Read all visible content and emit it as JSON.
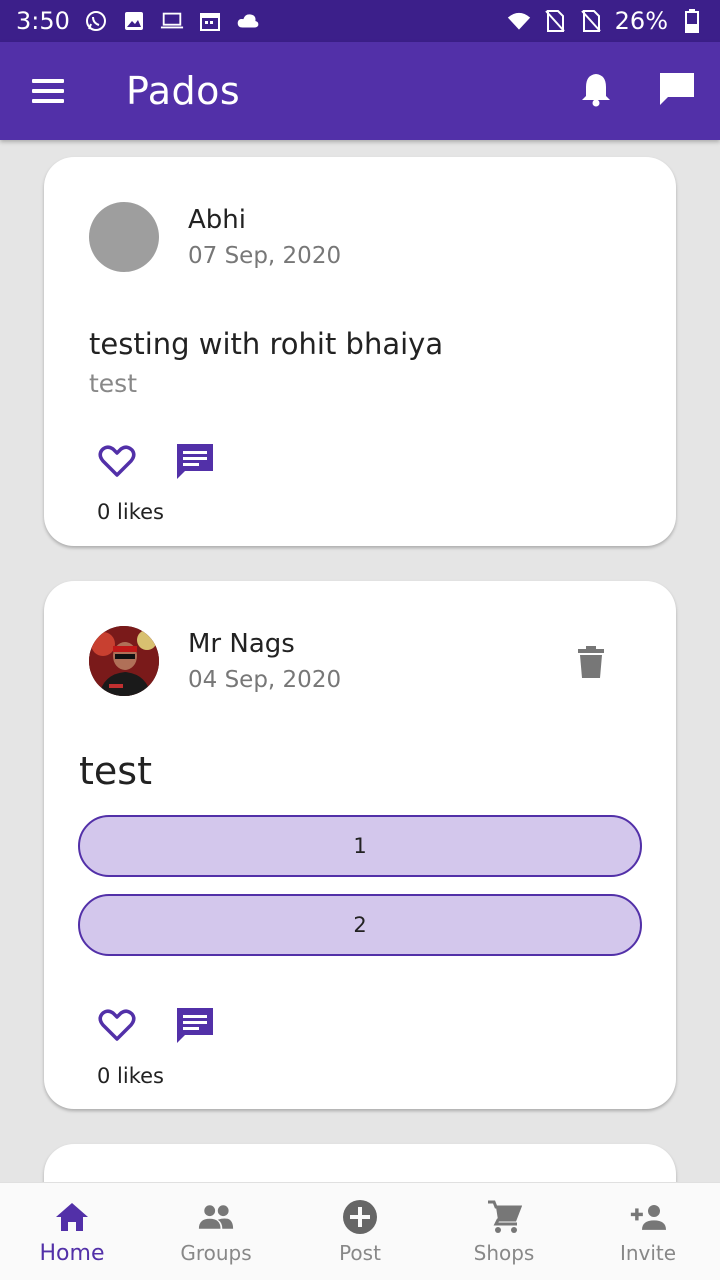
{
  "status_bar": {
    "time": "3:50",
    "battery": "26%"
  },
  "app_bar": {
    "title": "Pados"
  },
  "posts": [
    {
      "author": "Abhi",
      "date": "07 Sep, 2020",
      "title": "testing with rohit bhaiya",
      "body": "test",
      "likes": "0 likes"
    },
    {
      "author": "Mr Nags",
      "date": "04 Sep, 2020",
      "title": "test",
      "options": [
        "1",
        "2"
      ],
      "likes": "0 likes"
    }
  ],
  "bottom_nav": [
    {
      "label": "Home",
      "icon": "home-icon",
      "active": true
    },
    {
      "label": "Groups",
      "icon": "groups-icon",
      "active": false
    },
    {
      "label": "Post",
      "icon": "add-circle-icon",
      "active": false
    },
    {
      "label": "Shops",
      "icon": "cart-icon",
      "active": false
    },
    {
      "label": "Invite",
      "icon": "add-person-icon",
      "active": false
    }
  ],
  "colors": {
    "primary": "#5230a8",
    "status_bar": "#3c1f8a",
    "poll_option_fill": "#d3c7ec"
  }
}
